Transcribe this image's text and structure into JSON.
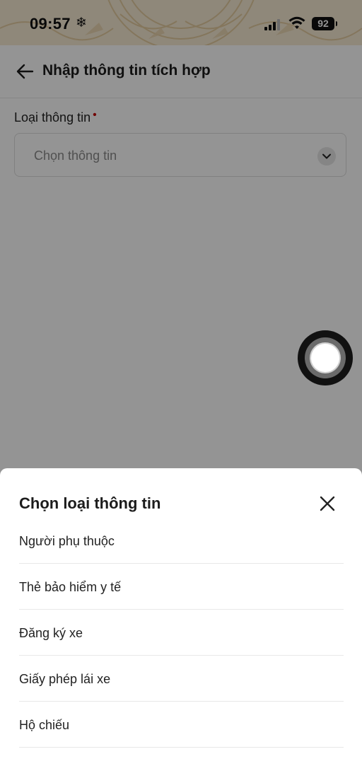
{
  "status_bar": {
    "time": "09:57",
    "weather_glyph": "❄",
    "battery_level": "92"
  },
  "header": {
    "title": "Nhập thông tin tích hợp",
    "back_icon": "arrow-left-icon"
  },
  "form": {
    "field_label": "Loại thông tin",
    "required_mark": "•",
    "select_placeholder": "Chọn thông tin"
  },
  "sheet": {
    "title": "Chọn loại thông tin",
    "close_icon": "close-icon",
    "options": [
      {
        "label": "Người phụ thuộc"
      },
      {
        "label": "Thẻ bảo hiểm y tế"
      },
      {
        "label": "Đăng ký xe"
      },
      {
        "label": "Giấy phép lái xe"
      },
      {
        "label": "Hộ chiếu"
      }
    ]
  },
  "colors": {
    "header_bg": "#f6ead3",
    "required": "#c40000",
    "overlay": "rgba(0,0,0,0.42)"
  }
}
